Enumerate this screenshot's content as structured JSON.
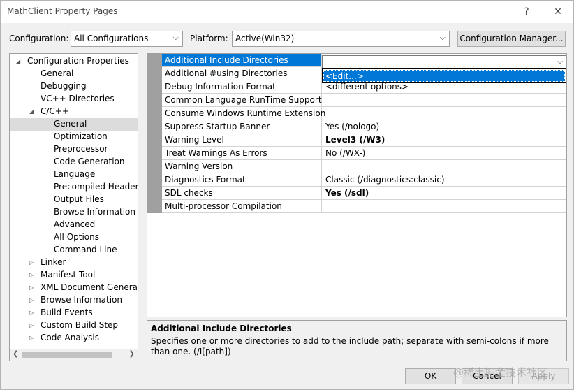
{
  "window": {
    "title": "MathClient Property Pages",
    "help_glyph": "?",
    "close_glyph": "✕"
  },
  "config": {
    "configuration_label": "Configuration:",
    "configuration_value": "All Configurations",
    "platform_label": "Platform:",
    "platform_value": "Active(Win32)",
    "manager_button": "Configuration Manager..."
  },
  "tree": {
    "items": [
      {
        "label": "Configuration Properties",
        "arrow": "◢",
        "level": 0
      },
      {
        "label": "General",
        "arrow": "",
        "level": 1
      },
      {
        "label": "Debugging",
        "arrow": "",
        "level": 1
      },
      {
        "label": "VC++ Directories",
        "arrow": "",
        "level": 1
      },
      {
        "label": "C/C++",
        "arrow": "◢",
        "level": 1
      },
      {
        "label": "General",
        "arrow": "",
        "level": 2
      },
      {
        "label": "Optimization",
        "arrow": "",
        "level": 2
      },
      {
        "label": "Preprocessor",
        "arrow": "",
        "level": 2
      },
      {
        "label": "Code Generation",
        "arrow": "",
        "level": 2
      },
      {
        "label": "Language",
        "arrow": "",
        "level": 2
      },
      {
        "label": "Precompiled Headers",
        "arrow": "",
        "level": 2
      },
      {
        "label": "Output Files",
        "arrow": "",
        "level": 2
      },
      {
        "label": "Browse Information",
        "arrow": "",
        "level": 2
      },
      {
        "label": "Advanced",
        "arrow": "",
        "level": 2
      },
      {
        "label": "All Options",
        "arrow": "",
        "level": 2
      },
      {
        "label": "Command Line",
        "arrow": "",
        "level": 2
      },
      {
        "label": "Linker",
        "arrow": "▷",
        "level": 1
      },
      {
        "label": "Manifest Tool",
        "arrow": "▷",
        "level": 1
      },
      {
        "label": "XML Document Generator",
        "arrow": "▷",
        "level": 1
      },
      {
        "label": "Browse Information",
        "arrow": "▷",
        "level": 1
      },
      {
        "label": "Build Events",
        "arrow": "▷",
        "level": 1
      },
      {
        "label": "Custom Build Step",
        "arrow": "▷",
        "level": 1
      },
      {
        "label": "Code Analysis",
        "arrow": "▷",
        "level": 1
      }
    ],
    "selected_index": 5
  },
  "properties": {
    "rows": [
      {
        "name": "Additional Include Directories",
        "value": "",
        "bold": false
      },
      {
        "name": "Additional #using Directories",
        "value": "",
        "bold": false
      },
      {
        "name": "Debug Information Format",
        "value": "<different options>",
        "bold": false
      },
      {
        "name": "Common Language RunTime Support",
        "value": "",
        "bold": false
      },
      {
        "name": "Consume Windows Runtime Extension",
        "value": "",
        "bold": false
      },
      {
        "name": "Suppress Startup Banner",
        "value": "Yes (/nologo)",
        "bold": false
      },
      {
        "name": "Warning Level",
        "value": "Level3 (/W3)",
        "bold": true
      },
      {
        "name": "Treat Warnings As Errors",
        "value": "No (/WX-)",
        "bold": false
      },
      {
        "name": "Warning Version",
        "value": "",
        "bold": false
      },
      {
        "name": "Diagnostics Format",
        "value": "Classic (/diagnostics:classic)",
        "bold": false
      },
      {
        "name": "SDL checks",
        "value": "Yes (/sdl)",
        "bold": true
      },
      {
        "name": "Multi-processor Compilation",
        "value": "",
        "bold": false
      }
    ],
    "selected_index": 0,
    "dropdown_option": "<Edit...>"
  },
  "description": {
    "title": "Additional Include Directories",
    "text": "Specifies one or more directories to add to the include path; separate with semi-colons if more than one.     (/I[path])"
  },
  "buttons": {
    "ok": "OK",
    "cancel": "Cancel",
    "apply": "Apply"
  },
  "watermark": "@稀土掘金技术社区"
}
